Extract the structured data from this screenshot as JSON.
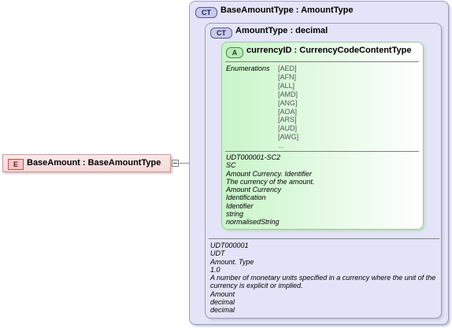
{
  "element": {
    "badge": "E",
    "label": "BaseAmount : BaseAmountType"
  },
  "outer_type": {
    "badge": "CT",
    "label": "BaseAmountType : AmountType"
  },
  "inner_type": {
    "badge": "CT",
    "label": "AmountType : decimal",
    "doc": [
      "UDT000001",
      "UDT",
      "Amount. Type",
      "1.0",
      "A number of monetary units specified in a currency where the unit of the",
      "currency is explicit or implied.",
      "Amount",
      "decimal",
      "decimal"
    ]
  },
  "attribute": {
    "badge": "A",
    "label": "currencyID : CurrencyCodeContentType",
    "enum_heading": "Enumerations",
    "enumerations": [
      "[AED]",
      "[AFN]",
      "[ALL]",
      "[AMD]",
      "[ANG]",
      "[AOA]",
      "[ARS]",
      "[AUD]",
      "[AWG]",
      "..."
    ],
    "doc": [
      "UDT000001-SC2",
      "SC",
      "Amount Currency. Identifier",
      "The currency of the amount.",
      "Amount Currency",
      "Identification",
      "Identifier",
      "string",
      "normalisedString"
    ]
  }
}
